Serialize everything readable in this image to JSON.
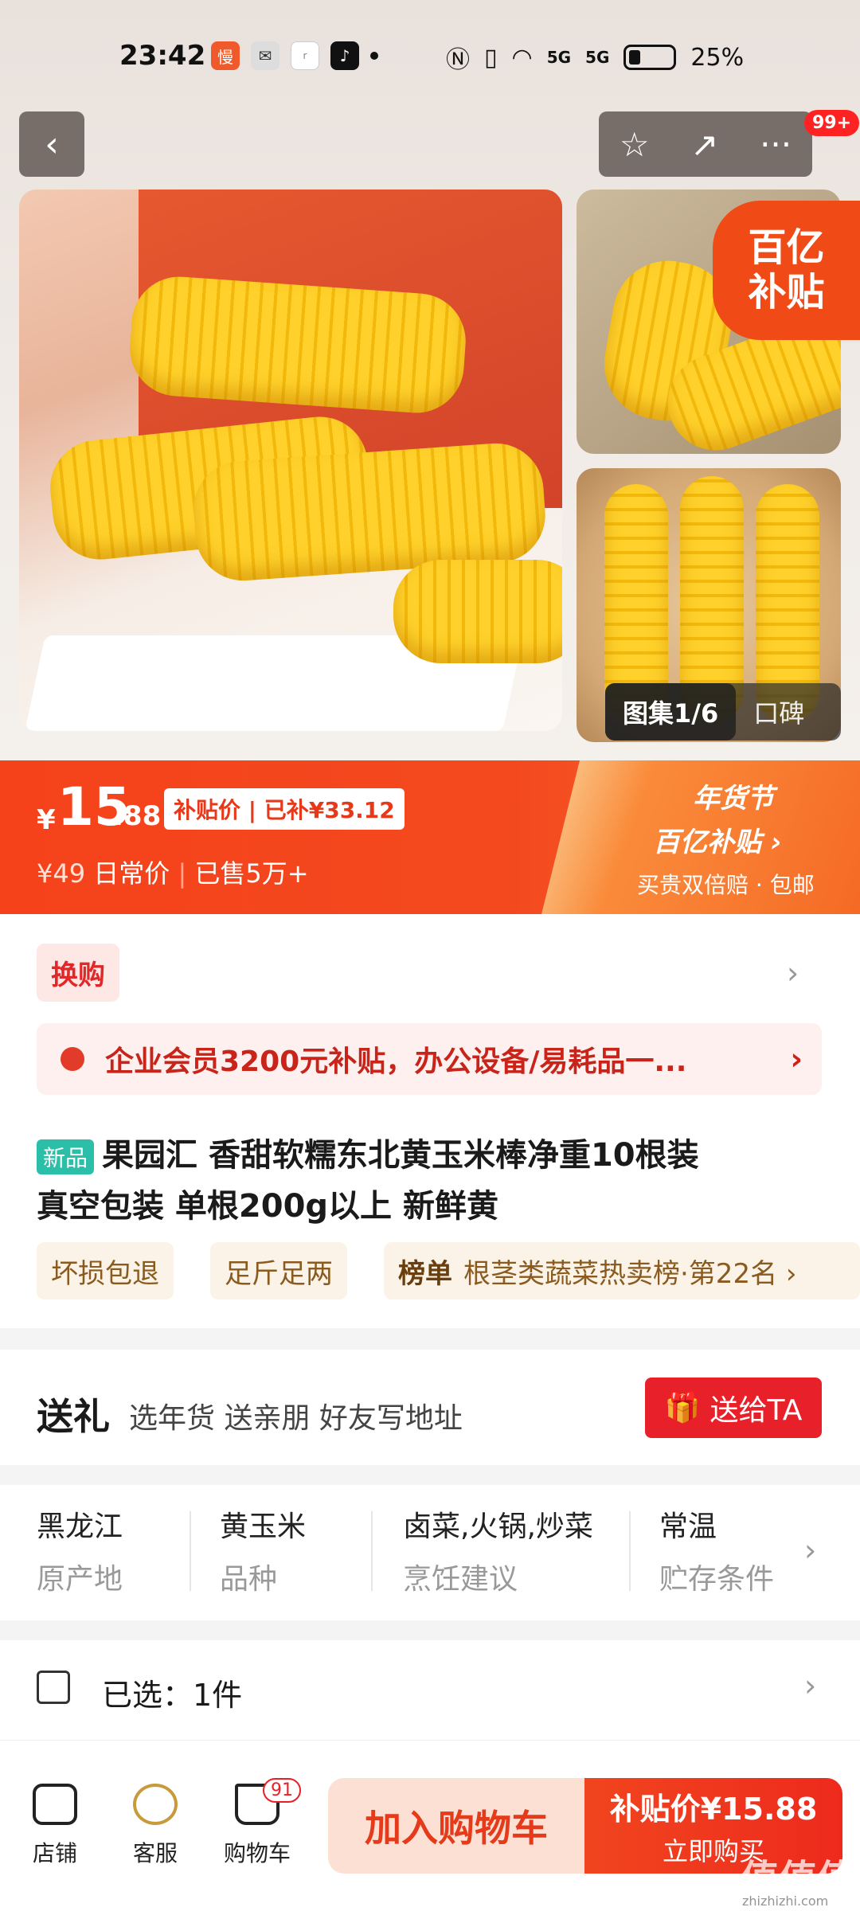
{
  "status_bar": {
    "time": "23:42",
    "battery": "25%",
    "net1": "5G",
    "net2": "5G"
  },
  "nav": {
    "back": "‹",
    "favorite": "☆",
    "share": "↗",
    "more": "···",
    "badge": "99+"
  },
  "gallery": {
    "subsidy_line1": "百亿",
    "subsidy_line2": "补贴",
    "pill_counter": "图集1/6",
    "pill_reviews": "口碑"
  },
  "price": {
    "currency": "¥",
    "integer": "15",
    "decimal": ".88",
    "tag": "补贴价 | 已补¥33.12",
    "original": "¥49",
    "original_label": "日常价",
    "sold": "已售5万+",
    "festival_title": "年货节",
    "festival_sub": "百亿补贴 ›",
    "festival_note": "买贵双倍赔 · 包邮"
  },
  "swap": {
    "label": "换购"
  },
  "promo": {
    "text": "企业会员3200元补贴，办公设备/易耗品一..."
  },
  "product": {
    "new_tag": "新品",
    "title_line1": "果园汇 香甜软糯东北黄玉米棒净重10根装",
    "title_line2": "真空包装 单根200g以上 新鲜黄",
    "chips": [
      "坏损包退",
      "足斤足两"
    ],
    "rank_label": "榜单",
    "rank_text": "根茎类蔬菜热卖榜·第22名 ›"
  },
  "gift": {
    "title": "送礼",
    "subtitle": "选年货 送亲朋 好友写地址",
    "button": "送给TA"
  },
  "attributes": [
    {
      "value": "黑龙江",
      "key": "原产地"
    },
    {
      "value": "黄玉米",
      "key": "品种"
    },
    {
      "value": "卤菜,火锅,炒菜",
      "key": "烹饪建议"
    },
    {
      "value": "常温",
      "key": "贮存条件"
    }
  ],
  "selection": {
    "text": "已选：1件"
  },
  "bottom": {
    "shop": "店铺",
    "service": "客服",
    "cart": "购物车",
    "cart_badge": "91",
    "add_cart": "加入购物车",
    "buy_price": "补贴价¥15.88",
    "buy_now": "立即购买"
  },
  "watermark": {
    "text": "值值值",
    "url": "zhizhizhi.com"
  }
}
